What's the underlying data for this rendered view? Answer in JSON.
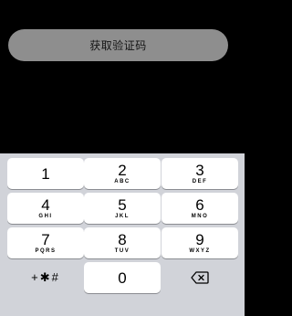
{
  "button": {
    "label": "获取验证码"
  },
  "keypad": {
    "keys": [
      {
        "digit": "1",
        "letters": ""
      },
      {
        "digit": "2",
        "letters": "ABC"
      },
      {
        "digit": "3",
        "letters": "DEF"
      },
      {
        "digit": "4",
        "letters": "GHI"
      },
      {
        "digit": "5",
        "letters": "JKL"
      },
      {
        "digit": "6",
        "letters": "MNO"
      },
      {
        "digit": "7",
        "letters": "PQRS"
      },
      {
        "digit": "8",
        "letters": "TUV"
      },
      {
        "digit": "9",
        "letters": "WXYZ"
      },
      {
        "digit": "0",
        "letters": ""
      }
    ],
    "symbols_label": "+✱#"
  },
  "icons": {
    "delete": "delete-icon"
  },
  "colors": {
    "screen_bg": "#000000",
    "button_bg": "#8e8e8e",
    "keyboard_bg": "#d1d3d9",
    "key_bg": "#ffffff"
  }
}
